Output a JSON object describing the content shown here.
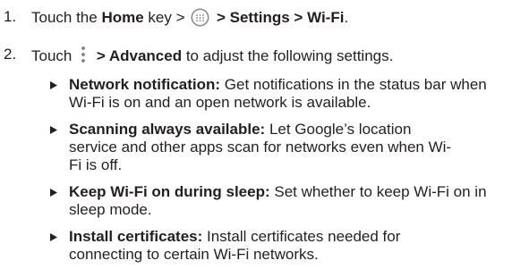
{
  "steps": [
    {
      "number": "1.",
      "parts": {
        "a": "Touch the ",
        "home": "Home",
        "b": " key > ",
        "c": " > ",
        "settings": "Settings",
        "d": " > ",
        "wifi": "Wi-Fi",
        "e": "."
      },
      "icon": "apps-grid-icon"
    },
    {
      "number": "2.",
      "parts": {
        "a": "Touch ",
        "b": " > ",
        "advanced": "Advanced",
        "c": " to adjust the following settings."
      },
      "icon": "menu-overflow-icon"
    }
  ],
  "bullets": [
    {
      "title": "Network notification:",
      "text": " Get notifications in the status bar when Wi-Fi is on and an open network is available."
    },
    {
      "title": "Scanning always available:",
      "text": " Let Google’s location service and other apps scan for networks even when Wi-Fi is off."
    },
    {
      "title": "Keep Wi-Fi on during sleep:",
      "text": " Set whether to keep Wi-Fi on in sleep mode."
    },
    {
      "title": "Install certificates:",
      "text": " Install certificates needed for connecting to certain Wi-Fi networks."
    }
  ],
  "colors": {
    "text": "#231f20",
    "icon": "#7f7f7f"
  }
}
